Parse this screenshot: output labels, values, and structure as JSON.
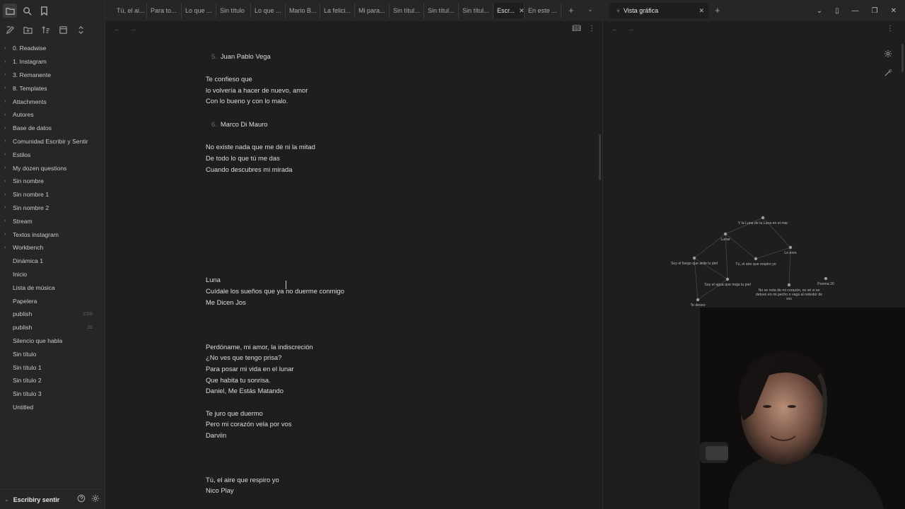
{
  "sidebar": {
    "top_icons": [
      "folder-icon",
      "search-icon",
      "bookmark-icon"
    ],
    "action_icons": [
      "new-note-icon",
      "new-folder-icon",
      "sort-icon",
      "collapse-icon",
      "expand-icon"
    ],
    "items": [
      {
        "label": "0. Readwise",
        "type": "folder"
      },
      {
        "label": "1. Instagram",
        "type": "folder"
      },
      {
        "label": "3. Remanente",
        "type": "folder"
      },
      {
        "label": "8. Templates",
        "type": "folder"
      },
      {
        "label": "Attachments",
        "type": "folder"
      },
      {
        "label": "Autores",
        "type": "folder"
      },
      {
        "label": "Base de datos",
        "type": "folder"
      },
      {
        "label": "Comunidad Escribir y Sentir",
        "type": "folder"
      },
      {
        "label": "Estilos",
        "type": "folder"
      },
      {
        "label": "My dozen questions",
        "type": "folder"
      },
      {
        "label": "Sin nombre",
        "type": "folder"
      },
      {
        "label": "Sin nombre 1",
        "type": "folder"
      },
      {
        "label": "Sin nombre 2",
        "type": "folder"
      },
      {
        "label": "Stream",
        "type": "folder"
      },
      {
        "label": "Textos instagram",
        "type": "folder"
      },
      {
        "label": "Workbench",
        "type": "folder"
      },
      {
        "label": "Dinámica 1",
        "type": "file"
      },
      {
        "label": "Inicio",
        "type": "file"
      },
      {
        "label": "Lista de música",
        "type": "file"
      },
      {
        "label": "Papelera",
        "type": "file"
      },
      {
        "label": "publish",
        "type": "file",
        "ext": "CSS"
      },
      {
        "label": "publish",
        "type": "file",
        "ext": "JS"
      },
      {
        "label": "Silencio que habla",
        "type": "file"
      },
      {
        "label": "Sin título",
        "type": "file"
      },
      {
        "label": "Sin título 1",
        "type": "file"
      },
      {
        "label": "Sin título 2",
        "type": "file"
      },
      {
        "label": "Sin título 3",
        "type": "file"
      },
      {
        "label": "Untitled",
        "type": "file"
      }
    ],
    "vault_name": "Escribiry sentir"
  },
  "tabs": [
    {
      "label": "Tú, el ai...",
      "active": false
    },
    {
      "label": "Para to...",
      "active": false
    },
    {
      "label": "Lo que ...",
      "active": false
    },
    {
      "label": "Sin título",
      "active": false
    },
    {
      "label": "Lo que ...",
      "active": false
    },
    {
      "label": "Mario B...",
      "active": false
    },
    {
      "label": "La felici...",
      "active": false
    },
    {
      "label": "Mi para...",
      "active": false
    },
    {
      "label": "Sin títul...",
      "active": false
    },
    {
      "label": "Sin títul...",
      "active": false
    },
    {
      "label": "Sin títul...",
      "active": false
    },
    {
      "label": "Escr...",
      "active": true
    },
    {
      "label": "En este ...",
      "active": false
    }
  ],
  "graph_tab": {
    "label": "Vista gráfica"
  },
  "document": {
    "lines": [
      {
        "text": "Juan Pablo Vega",
        "num": "5."
      },
      {
        "text": "Te confieso que"
      },
      {
        "text": "lo volvería a hacer de nuevo, amor"
      },
      {
        "text": "Con lo bueno y con lo malo."
      },
      {
        "text": "Marco Di Mauro",
        "num": "6."
      },
      {
        "text": "No existe nada que me dé ni la mitad"
      },
      {
        "text": "De todo lo que tú me das"
      },
      {
        "text": "Cuando descubres mi mirada"
      },
      {
        "text": "Luna"
      },
      {
        "text": "Cuídale los sueños que ya no duerme conmigo"
      },
      {
        "text": "Me Dicen Jos"
      },
      {
        "text": "Perdóname, mi amor, la indiscreción"
      },
      {
        "text": "¿No ves que tengo prisa?"
      },
      {
        "text": "Para posar mi vida en el lunar"
      },
      {
        "text": "Que habita tu sonrisa."
      },
      {
        "text": "Daniel, Me Estás Matando"
      },
      {
        "text": "Te juro que duermo"
      },
      {
        "text": "Pero mi corazón vela por vos"
      },
      {
        "text": "Darviin"
      },
      {
        "text": "Tú, el aire que respiro yo"
      },
      {
        "text": "Nico Play"
      }
    ]
  },
  "graph": {
    "nodes": [
      {
        "label": "Y la Luna de la Luna en el mar"
      },
      {
        "label": "Lunar"
      },
      {
        "label": "Lo eres"
      },
      {
        "label": "Soy el fuego que arde tu piel"
      },
      {
        "label": "Tú, el aire que respiro yo"
      },
      {
        "label": "Soy el agua que moja tu piel"
      },
      {
        "label": "Poema 20"
      },
      {
        "label": "No se nota de mi corazón, no sé si se detuvo en mi pecho o vaga al rededor de vos"
      },
      {
        "label": "Te deseo"
      }
    ]
  },
  "colors": {
    "background": "#1e1e1e",
    "sidebar": "#262626",
    "text": "#dcddde",
    "muted": "#8a8a8a"
  }
}
